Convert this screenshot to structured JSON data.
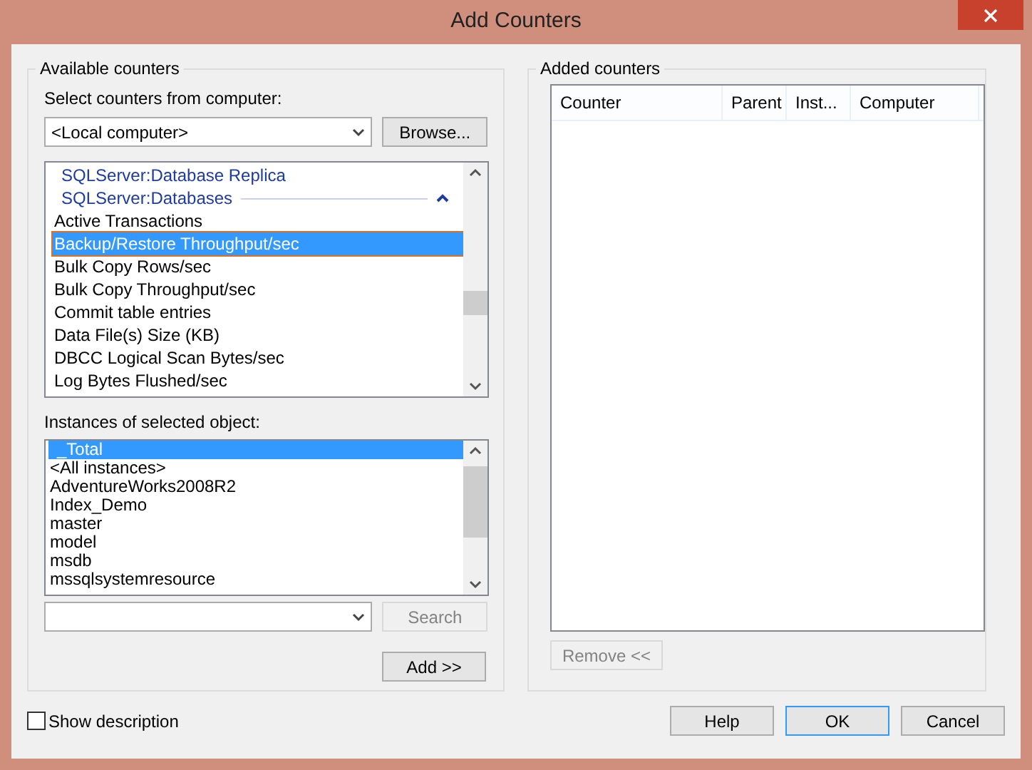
{
  "window": {
    "title": "Add Counters"
  },
  "available": {
    "title": "Available counters",
    "computer_label": "Select counters from computer:",
    "computer_value": "<Local computer>",
    "browse_button": "Browse...",
    "counters": [
      {
        "kind": "group",
        "label": "SQLServer:Database Replica",
        "selected": false,
        "expanded": false
      },
      {
        "kind": "group",
        "label": "SQLServer:Databases",
        "selected": false,
        "expanded": true
      },
      {
        "kind": "counter",
        "label": "Active Transactions",
        "selected": false
      },
      {
        "kind": "counter",
        "label": "Backup/Restore Throughput/sec",
        "selected": true
      },
      {
        "kind": "counter",
        "label": "Bulk Copy Rows/sec",
        "selected": false
      },
      {
        "kind": "counter",
        "label": "Bulk Copy Throughput/sec",
        "selected": false
      },
      {
        "kind": "counter",
        "label": "Commit table entries",
        "selected": false
      },
      {
        "kind": "counter",
        "label": "Data File(s) Size (KB)",
        "selected": false
      },
      {
        "kind": "counter",
        "label": "DBCC Logical Scan Bytes/sec",
        "selected": false
      },
      {
        "kind": "counter",
        "label": "Log Bytes Flushed/sec",
        "selected": false
      }
    ],
    "instances_label": "Instances of selected object:",
    "instances": [
      {
        "label": "_Total",
        "selected": true
      },
      {
        "label": "<All instances>",
        "selected": false
      },
      {
        "label": "AdventureWorks2008R2",
        "selected": false
      },
      {
        "label": "Index_Demo",
        "selected": false
      },
      {
        "label": "master",
        "selected": false
      },
      {
        "label": "model",
        "selected": false
      },
      {
        "label": "msdb",
        "selected": false
      },
      {
        "label": "mssqlsystemresource",
        "selected": false
      }
    ],
    "search_button": {
      "label": "Search",
      "disabled": true
    },
    "add_button": "Add >>"
  },
  "added": {
    "title": "Added counters",
    "columns": [
      "Counter",
      "Parent",
      "Inst...",
      "Computer"
    ],
    "remove_button": {
      "label": "Remove <<",
      "disabled": true
    }
  },
  "show_description": {
    "label": "Show description",
    "checked": false
  },
  "buttons": [
    {
      "label": "Help",
      "default": false
    },
    {
      "label": "OK",
      "default": true
    },
    {
      "label": "Cancel",
      "default": false
    }
  ]
}
